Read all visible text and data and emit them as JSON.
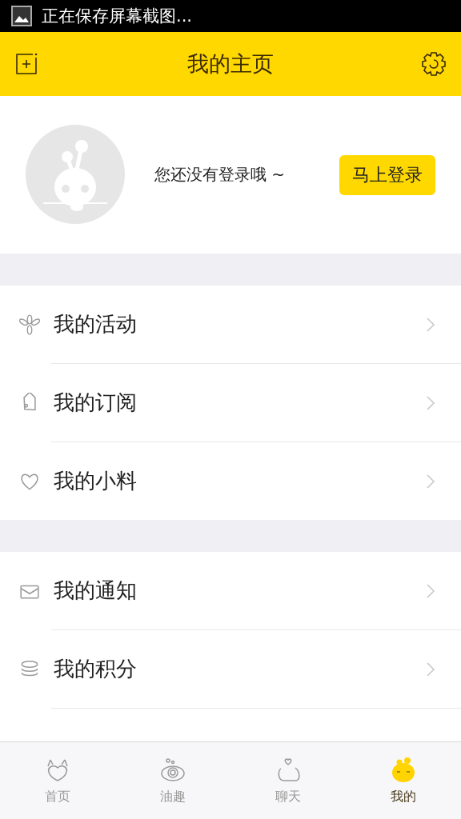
{
  "status_bar": {
    "text": "正在保存屏幕截图..."
  },
  "header": {
    "title": "我的主页"
  },
  "profile": {
    "prompt": "您还没有登录哦 ~",
    "login_button": "马上登录"
  },
  "menu_groups": [
    [
      {
        "label": "我的活动"
      },
      {
        "label": "我的订阅"
      },
      {
        "label": "我的小料"
      }
    ],
    [
      {
        "label": "我的通知"
      },
      {
        "label": "我的积分"
      }
    ]
  ],
  "tabs": [
    {
      "label": "首页",
      "selected": false
    },
    {
      "label": "油趣",
      "selected": false
    },
    {
      "label": "聊天",
      "selected": false
    },
    {
      "label": "我的",
      "selected": true
    }
  ]
}
